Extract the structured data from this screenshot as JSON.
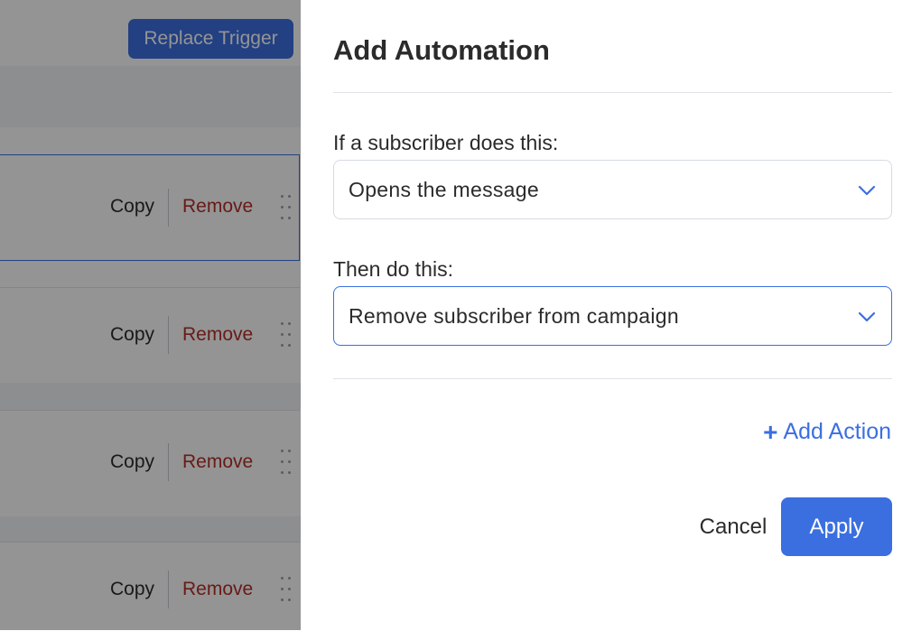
{
  "background": {
    "replace_trigger_label": "Replace Trigger",
    "cards": [
      {
        "copy": "Copy",
        "remove": "Remove"
      },
      {
        "copy": "Copy",
        "remove": "Remove"
      },
      {
        "copy": "Copy",
        "remove": "Remove"
      },
      {
        "copy": "Copy",
        "remove": "Remove"
      }
    ]
  },
  "modal": {
    "title": "Add Automation",
    "trigger_label": "If a subscriber does this:",
    "trigger_value": "Opens the message",
    "action_label": "Then do this:",
    "action_value": "Remove subscriber from campaign",
    "add_action_label": "Add Action",
    "cancel_label": "Cancel",
    "apply_label": "Apply"
  },
  "colors": {
    "accent": "#3b6fe0",
    "danger": "#b4302a",
    "text": "#2b2b2b"
  },
  "icons": {
    "select_chevron": "chevron-down-icon",
    "drag": "drag-handle-icon",
    "add": "plus-icon"
  }
}
